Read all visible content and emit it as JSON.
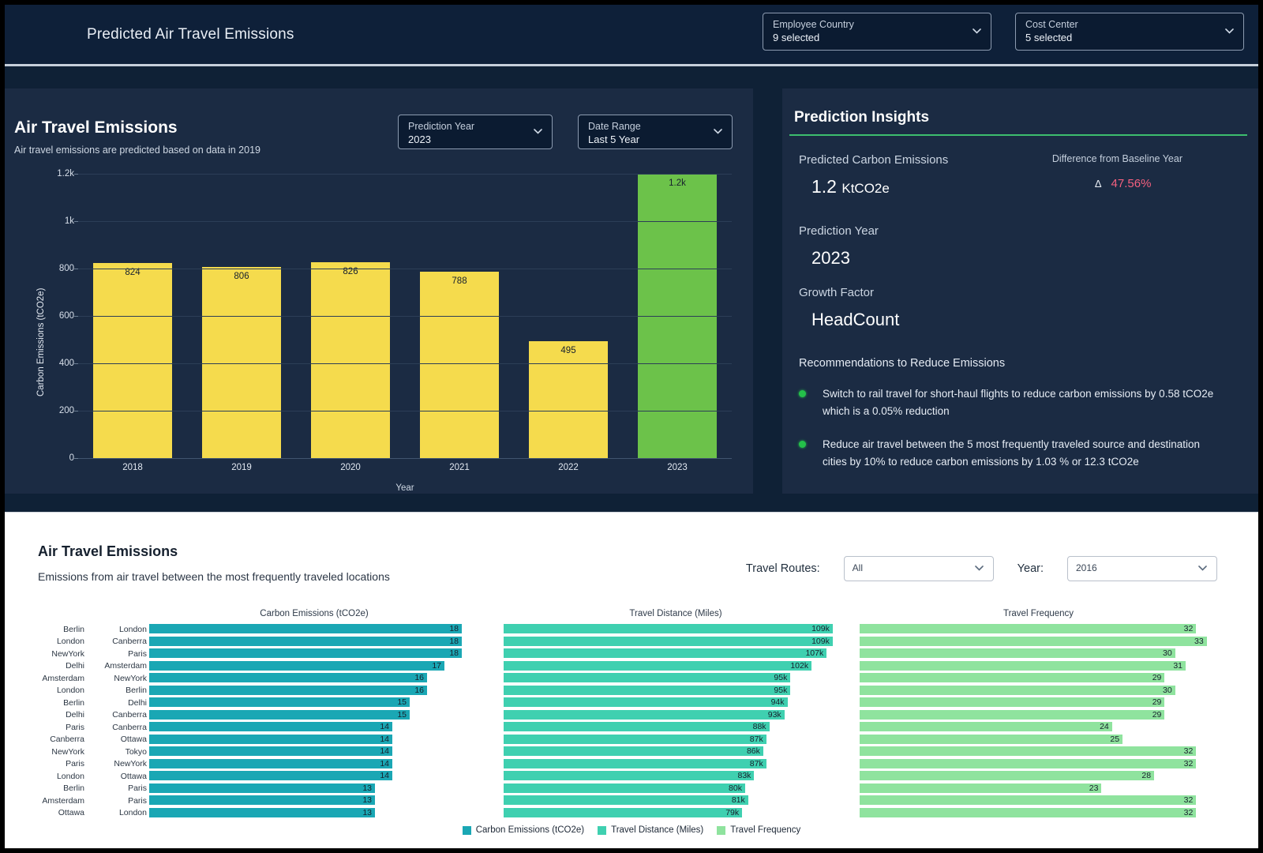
{
  "header": {
    "title": "Predicted Air Travel Emissions",
    "filters": [
      {
        "label": "Employee Country",
        "value": "9 selected",
        "icon": "chevron-down-icon"
      },
      {
        "label": "Cost Center",
        "value": "5 selected",
        "icon": "chevron-down-icon"
      }
    ]
  },
  "emissions_card": {
    "title": "Air Travel Emissions",
    "subtitle": "Air travel emissions are predicted based on data in 2019",
    "filters": [
      {
        "label": "Prediction Year",
        "value": "2023"
      },
      {
        "label": "Date Range",
        "value": "Last 5 Year"
      }
    ]
  },
  "insights": {
    "title": "Prediction Insights",
    "predicted_label": "Predicted Carbon Emissions",
    "predicted_value": "1.2",
    "predicted_unit": "KtCO2e",
    "difference_label": "Difference from Baseline Year",
    "difference_value": "47.56%",
    "difference_symbol": "Δ",
    "difference_color": "#f4607f",
    "prediction_year_label": "Prediction Year",
    "prediction_year_value": "2023",
    "growth_factor_label": "Growth Factor",
    "growth_factor_value": "HeadCount",
    "recommendations_label": "Recommendations to Reduce Emissions",
    "recommendations": [
      "Switch to rail travel for short-haul flights to reduce carbon emissions by 0.58 tCO2e which is a 0.05% reduction",
      "Reduce air travel between the 5 most frequently traveled source and destination cities by 10%  to reduce carbon emissions by 1.03 % or 12.3 tCO2e"
    ]
  },
  "routes_card": {
    "title": "Air Travel Emissions",
    "subtitle": "Emissions from air travel between the most frequently  traveled locations",
    "travel_routes_label": "Travel Routes:",
    "travel_routes_value": "All",
    "year_label": "Year:",
    "year_value": "2016"
  },
  "chart_data": [
    {
      "type": "bar",
      "title": "Air Travel Emissions",
      "xlabel": "Year",
      "ylabel": "Carbon Emissions (tCO2e)",
      "categories": [
        "2018",
        "2019",
        "2020",
        "2021",
        "2022",
        "2023"
      ],
      "values": [
        824,
        806,
        826,
        788,
        495,
        1200
      ],
      "labels": [
        "824",
        "806",
        "826",
        "788",
        "495",
        "1.2k"
      ],
      "colors": [
        "#f5db4d",
        "#f5db4d",
        "#f5db4d",
        "#f5db4d",
        "#f5db4d",
        "#6cc24a"
      ],
      "ylim": [
        0,
        1200
      ],
      "yticks": [
        0,
        200,
        400,
        600,
        800,
        1000,
        1200
      ],
      "ytick_labels": [
        "0",
        "200",
        "400",
        "600",
        "800",
        "1k",
        "1.2k"
      ],
      "grid": true,
      "legend": "none"
    },
    {
      "type": "bar",
      "orientation": "horizontal",
      "title": "Carbon Emissions (tCO2e)",
      "categories": [
        "Berlin → London",
        "London → Canberra",
        "NewYork → Paris",
        "Delhi → Amsterdam",
        "Amsterdam → NewYork",
        "London → Berlin",
        "Berlin → Delhi",
        "Delhi → Canberra",
        "Paris → Canberra",
        "Canberra → Ottawa",
        "NewYork → Tokyo",
        "Paris → NewYork",
        "London → Ottawa",
        "Berlin → Paris",
        "Amsterdam → Paris",
        "Ottawa → London"
      ],
      "values": [
        18,
        18,
        18,
        17,
        16,
        16,
        15,
        15,
        14,
        14,
        14,
        14,
        14,
        13,
        13,
        13
      ],
      "labels": [
        "18",
        "18",
        "18",
        "17",
        "16",
        "16",
        "15",
        "15",
        "14",
        "14",
        "14",
        "14",
        "14",
        "13",
        "13",
        "13"
      ],
      "color": "#1aa7b4",
      "xlim": [
        0,
        19
      ]
    },
    {
      "type": "bar",
      "orientation": "horizontal",
      "title": "Travel Distance (Miles)",
      "values": [
        109000,
        109000,
        107000,
        102000,
        95000,
        95000,
        94000,
        93000,
        88000,
        87000,
        86000,
        87000,
        83000,
        80000,
        81000,
        79000
      ],
      "labels": [
        "109k",
        "109k",
        "107k",
        "102k",
        "95k",
        "95k",
        "94k",
        "93k",
        "88k",
        "87k",
        "86k",
        "87k",
        "83k",
        "80k",
        "81k",
        "79k"
      ],
      "color": "#3fd0b0",
      "xlim": [
        0,
        114000
      ]
    },
    {
      "type": "bar",
      "orientation": "horizontal",
      "title": "Travel Frequency",
      "values": [
        32,
        33,
        30,
        31,
        29,
        30,
        29,
        29,
        24,
        25,
        32,
        32,
        28,
        23,
        32,
        32
      ],
      "labels": [
        "32",
        "33",
        "30",
        "31",
        "29",
        "30",
        "29",
        "29",
        "24",
        "25",
        "32",
        "32",
        "28",
        "23",
        "32",
        "32"
      ],
      "color": "#8fe39e",
      "xlim": [
        0,
        34
      ]
    }
  ],
  "routes_table": {
    "sources": [
      "Berlin",
      "London",
      "NewYork",
      "Delhi",
      "Amsterdam",
      "London",
      "Berlin",
      "Delhi",
      "Paris",
      "Canberra",
      "NewYork",
      "Paris",
      "London",
      "Berlin",
      "Amsterdam",
      "Ottawa"
    ],
    "destinations": [
      "London",
      "Canberra",
      "Paris",
      "Amsterdam",
      "NewYork",
      "Berlin",
      "Delhi",
      "Canberra",
      "Canberra",
      "Ottawa",
      "Tokyo",
      "NewYork",
      "Ottawa",
      "Paris",
      "Paris",
      "London"
    ]
  },
  "legend": [
    {
      "label": "Carbon Emissions (tCO2e)",
      "color": "#1aa7b4"
    },
    {
      "label": "Travel Distance (Miles)",
      "color": "#3fd0b0"
    },
    {
      "label": "Travel Frequency",
      "color": "#8fe39e"
    }
  ]
}
